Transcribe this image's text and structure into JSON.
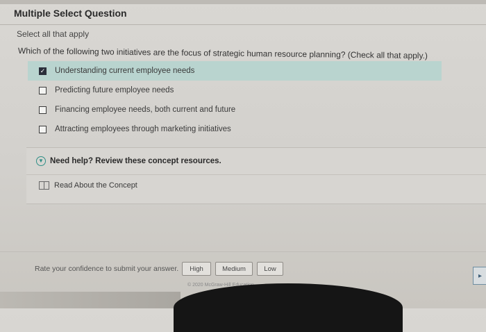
{
  "question": {
    "type_title": "Multiple Select Question",
    "instruction": "Select all that apply",
    "prompt": "Which of the following two initiatives are the focus of strategic human resource planning? (Check all that apply.)"
  },
  "options": [
    {
      "label": "Understanding current employee needs",
      "checked": true
    },
    {
      "label": "Predicting future employee needs",
      "checked": false
    },
    {
      "label": "Financing employee needs, both current and future",
      "checked": false
    },
    {
      "label": "Attracting employees through marketing initiatives",
      "checked": false
    }
  ],
  "help": {
    "title": "Need help? Review these concept resources.",
    "read_concept": "Read About the Concept"
  },
  "confidence": {
    "label": "Rate your confidence to submit your answer.",
    "high": "High",
    "medium": "Medium",
    "low": "Low"
  },
  "footer": {
    "copyright": "© 2020 McGraw-Hill Education"
  },
  "colors": {
    "selected_bg": "#b9d4cf",
    "accent": "#2f8f86"
  },
  "icons": {
    "help": "chevron-circle-icon",
    "read": "book-icon"
  }
}
